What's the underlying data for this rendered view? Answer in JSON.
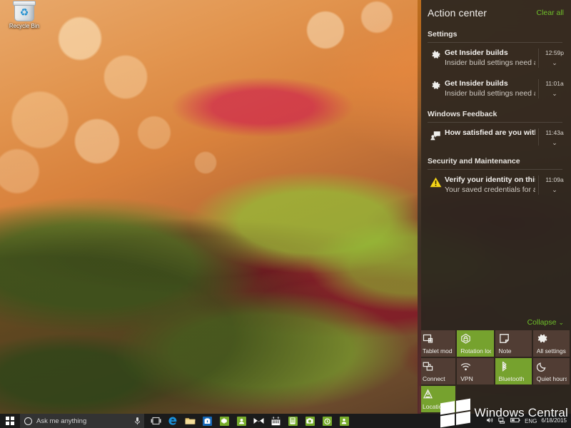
{
  "desktop": {
    "icons": [
      {
        "name": "recycle-bin",
        "label": "Recycle Bin"
      }
    ]
  },
  "action_center": {
    "title": "Action center",
    "clear_all_label": "Clear all",
    "collapse_label": "Collapse",
    "collapse_chevron": "⌄",
    "accent_color": "#76a22e",
    "link_color": "#6fbf2a",
    "panel_color": "#2a251e",
    "groups": [
      {
        "title": "Settings",
        "notifications": [
          {
            "icon": "gear-icon",
            "title": "Get Insider builds",
            "subtitle": "Insider build settings need attention",
            "time": "12:59p",
            "chevron": "⌄"
          },
          {
            "icon": "gear-icon",
            "title": "Get Insider builds",
            "subtitle": "Insider build settings need attention",
            "time": "11:01a",
            "chevron": "⌄"
          }
        ]
      },
      {
        "title": "Windows Feedback",
        "notifications": [
          {
            "icon": "feedback-icon",
            "title": "How satisfied are you with using th",
            "subtitle": "",
            "time": "11:43a",
            "chevron": "⌄"
          }
        ]
      },
      {
        "title": "Security and Maintenance",
        "notifications": [
          {
            "icon": "warning-icon",
            "title": "Verify your identity on this PC",
            "subtitle": "Your saved credentials for apps, web",
            "time": "11:09a",
            "chevron": "⌄"
          }
        ]
      }
    ],
    "quick_actions": [
      {
        "label": "Tablet mode",
        "icon": "tablet-mode-icon",
        "active": false
      },
      {
        "label": "Rotation lock",
        "icon": "rotation-lock-icon",
        "active": true
      },
      {
        "label": "Note",
        "icon": "note-icon",
        "active": false
      },
      {
        "label": "All settings",
        "icon": "all-settings-icon",
        "active": false
      },
      {
        "label": "Connect",
        "icon": "connect-icon",
        "active": false
      },
      {
        "label": "VPN",
        "icon": "vpn-icon",
        "active": false
      },
      {
        "label": "Bluetooth",
        "icon": "bluetooth-icon",
        "active": true
      },
      {
        "label": "Quiet hours",
        "icon": "moon-icon",
        "active": false
      },
      {
        "label": "Location",
        "icon": "location-icon",
        "active": true
      }
    ]
  },
  "taskbar": {
    "start_label": "Start",
    "search": {
      "placeholder": "Ask me anything",
      "value": "",
      "icon": "cortana-circle-icon",
      "mic_icon": "microphone-icon"
    },
    "apps": [
      {
        "name": "task-view-icon",
        "label": "Task View"
      },
      {
        "name": "microsoft-edge-icon",
        "label": "Microsoft Edge"
      },
      {
        "name": "file-explorer-icon",
        "label": "File Explorer"
      },
      {
        "name": "store-icon",
        "label": "Store"
      },
      {
        "name": "settings-icon",
        "label": "Settings"
      },
      {
        "name": "people-icon",
        "label": "People"
      },
      {
        "name": "mail-icon",
        "label": "Mail"
      },
      {
        "name": "calendar-icon",
        "label": "Calendar"
      },
      {
        "name": "calculator-icon",
        "label": "Calculator"
      },
      {
        "name": "camera-icon",
        "label": "Camera"
      },
      {
        "name": "alarms-icon",
        "label": "Alarms & Clock"
      },
      {
        "name": "contact-support-icon",
        "label": "Contact Support"
      }
    ],
    "tray": {
      "volume_icon": "speaker-icon",
      "network_icon": "network-icon",
      "battery_icon": "battery-icon",
      "language": "ENG",
      "date": "6/18/2015",
      "action_center_icon": "action-center-icon"
    }
  },
  "watermark": {
    "text": "Windows Central"
  }
}
